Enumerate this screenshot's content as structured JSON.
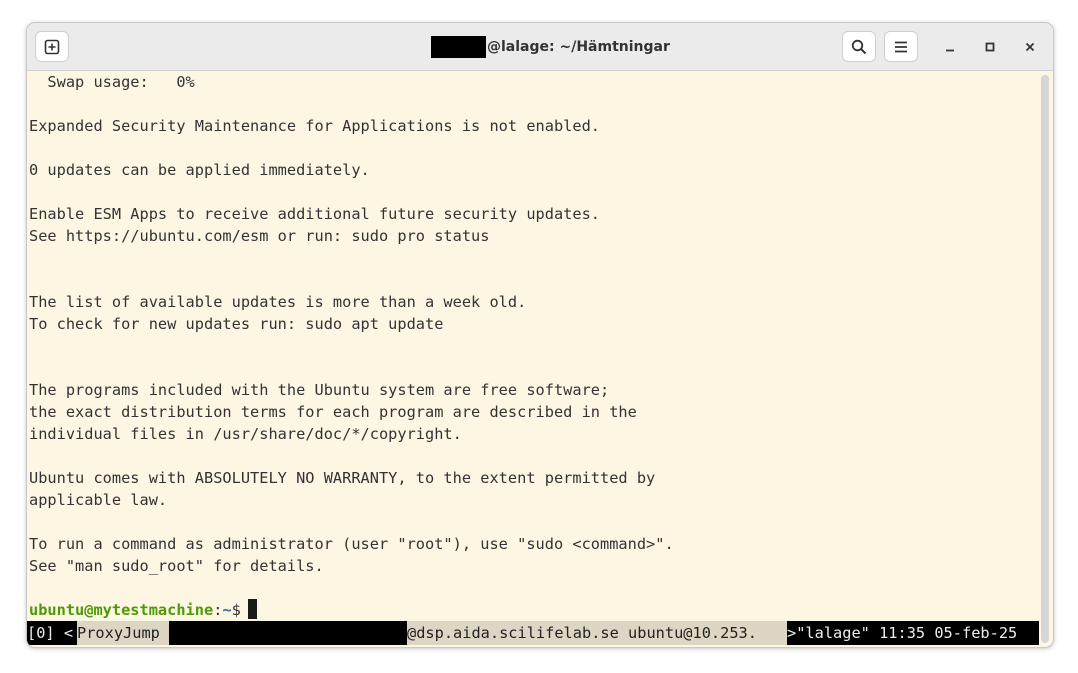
{
  "window": {
    "title_suffix": "@lalage: ~/Hämtningar",
    "icons": {
      "new_tab": "new-tab-icon",
      "search": "search-icon",
      "menu": "hamburger-icon",
      "minimize": "minimize-icon",
      "maximize": "maximize-icon",
      "close": "close-icon"
    }
  },
  "terminal": {
    "lines": [
      "  Swap usage:   0%",
      "",
      "Expanded Security Maintenance for Applications is not enabled.",
      "",
      "0 updates can be applied immediately.",
      "",
      "Enable ESM Apps to receive additional future security updates.",
      "See https://ubuntu.com/esm or run: sudo pro status",
      "",
      "",
      "The list of available updates is more than a week old.",
      "To check for new updates run: sudo apt update",
      "",
      "",
      "The programs included with the Ubuntu system are free software;",
      "the exact distribution terms for each program are described in the",
      "individual files in /usr/share/doc/*/copyright.",
      "",
      "Ubuntu comes with ABSOLUTELY NO WARRANTY, to the extent permitted by",
      "applicable law.",
      "",
      "To run a command as administrator (user \"root\"), use \"sudo <command>\".",
      "See \"man sudo_root\" for details.",
      ""
    ],
    "prompt": {
      "user_host": "ubuntu@mytestmachine",
      "colon": ":",
      "path": "~",
      "symbol": "$"
    }
  },
  "statusbar": {
    "window_index": "[0] <",
    "proxy_label": "ProxyJump",
    "host_suffix": "@dsp.aida.scilifelab.se ubuntu@10.253.",
    "window_name": ">\"lalage\" 11:35 05-feb-25"
  }
}
